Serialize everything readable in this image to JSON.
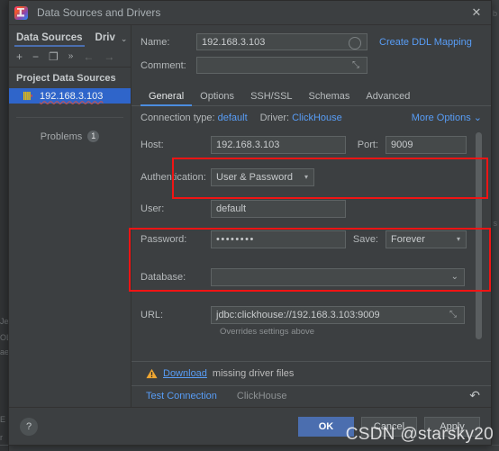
{
  "window": {
    "title": "Data Sources and Drivers",
    "app_icon": "datagrip-icon",
    "close_label": "✕"
  },
  "sidebar": {
    "tabs": [
      {
        "label": "Data Sources",
        "active": true
      },
      {
        "label": "Driv",
        "active": false
      }
    ],
    "chevron": "⌄",
    "toolbar": [
      {
        "name": "add-icon",
        "glyph": "+"
      },
      {
        "name": "remove-icon",
        "glyph": "−"
      },
      {
        "name": "duplicate-icon",
        "glyph": "❐"
      },
      {
        "name": "more-icon",
        "glyph": "»"
      },
      {
        "name": "back-arrow-icon",
        "glyph": "←"
      },
      {
        "name": "forward-arrow-icon",
        "glyph": "→"
      }
    ],
    "section_title": "Project Data Sources",
    "items": [
      {
        "label": "192.168.3.103",
        "icon": "clickhouse-icon",
        "selected": true
      }
    ],
    "problems": {
      "label": "Problems",
      "count": "1"
    }
  },
  "form": {
    "name_label": "Name:",
    "name_value": "192.168.3.103",
    "create_ddl_mapping": "Create DDL Mapping",
    "comment_label": "Comment:",
    "comment_value": "",
    "expand_icon": "⤡"
  },
  "tabs": [
    {
      "label": "General",
      "active": true
    },
    {
      "label": "Options",
      "active": false
    },
    {
      "label": "SSH/SSL",
      "active": false
    },
    {
      "label": "Schemas",
      "active": false
    },
    {
      "label": "Advanced",
      "active": false
    }
  ],
  "connection": {
    "type_label": "Connection type:",
    "type_value": "default",
    "driver_label": "Driver:",
    "driver_value": "ClickHouse",
    "more_options": "More Options",
    "more_options_chevron": "⌄"
  },
  "fields": {
    "host_label": "Host:",
    "host_value": "192.168.3.103",
    "port_label": "Port:",
    "port_value": "9009",
    "auth_label": "Authentication:",
    "auth_value": "User & Password",
    "user_label": "User:",
    "user_value": "default",
    "password_label": "Password:",
    "password_value": "••••••••",
    "save_label": "Save:",
    "save_value": "Forever",
    "database_label": "Database:",
    "database_value": "",
    "url_label": "URL:",
    "url_value": "jdbc:clickhouse://192.168.3.103:9009",
    "url_hint": "Overrides settings above",
    "dropdown_arrow": "▾",
    "chevron_down": "⌄"
  },
  "status": {
    "warning_icon": "warning-triangle-icon",
    "download_link": "Download",
    "download_rest": "missing driver files",
    "test_connection": "Test Connection",
    "driver_name": "ClickHouse",
    "revert_icon": "↶"
  },
  "footer": {
    "help_label": "?",
    "ok_label": "OK",
    "cancel_label": "Cancel",
    "apply_label": "Apply"
  },
  "watermark": "CSDN @starsky20",
  "background": {
    "ghost_lines": [
      "Je",
      "OL",
      "ae",
      "E",
      "r"
    ],
    "right_labels": [
      "b",
      "s"
    ]
  },
  "colors": {
    "accent_blue": "#4b6eaf",
    "link_blue": "#589df6",
    "selection_blue": "#2f65ca",
    "annotation_red": "#f01414",
    "warning_orange": "#f0a732",
    "panel_bg": "#3c3f41",
    "field_bg": "#45494a"
  }
}
